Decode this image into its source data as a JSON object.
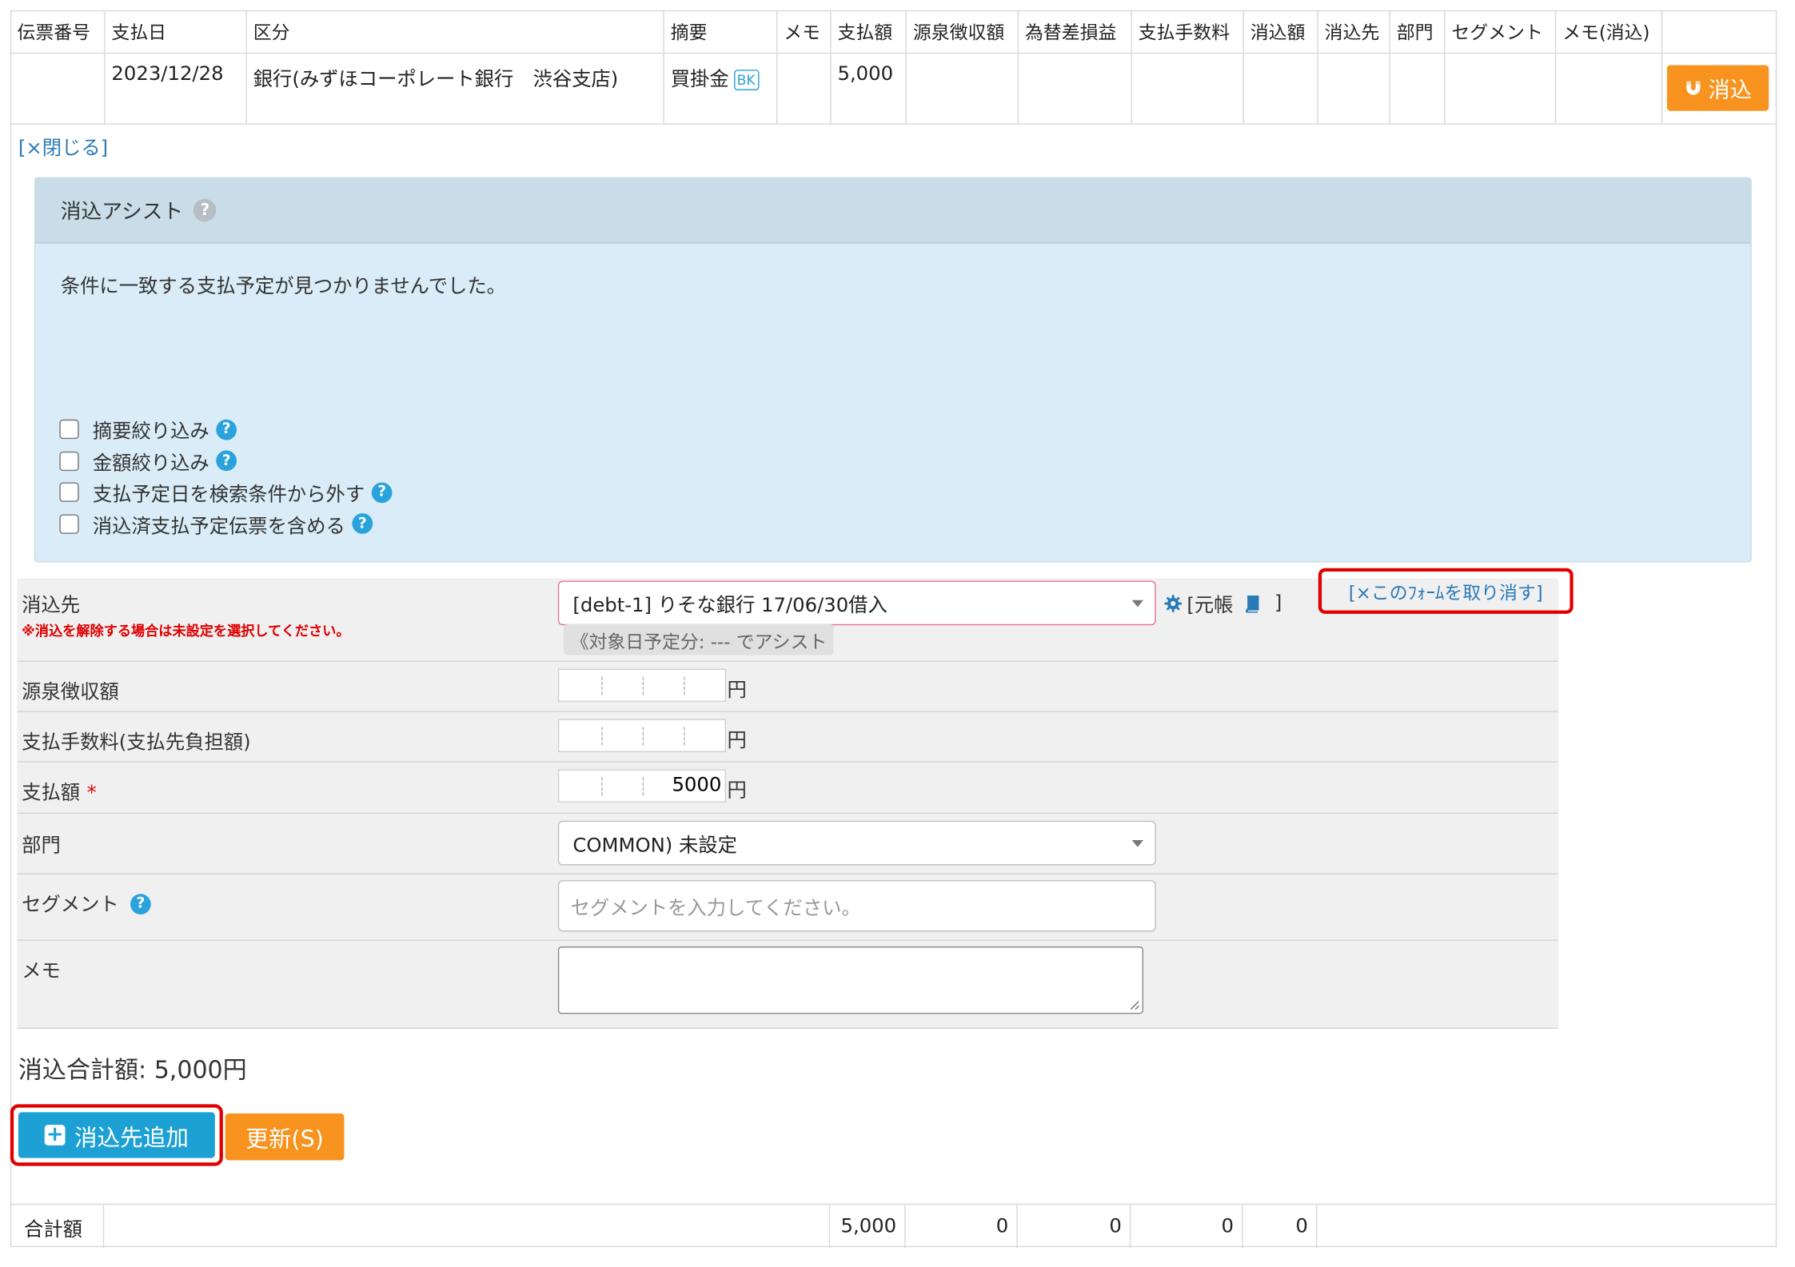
{
  "header": {
    "columns": [
      "伝票番号",
      "支払日",
      "区分",
      "摘要",
      "メモ",
      "支払額",
      "源泉徴収額",
      "為替差損益",
      "支払手数料",
      "消込額",
      "消込先",
      "部門",
      "セグメント",
      "メモ(消込)"
    ]
  },
  "entry": {
    "slip_no": "",
    "date": "2023/12/28",
    "category": "銀行(みずほコーポレート銀行　渋谷支店)",
    "summary": "買掛金",
    "summary_badge": "BK",
    "memo": "",
    "amount": "5,000",
    "withholding": "",
    "fx": "",
    "fee": "",
    "cleared": "",
    "target": "",
    "dept": "",
    "segment": "",
    "memo_clear": "",
    "clear_button": "消込"
  },
  "close_link": "[×閉じる]",
  "assist": {
    "title": "消込アシスト",
    "message": "条件に一致する支払予定が見つかりませんでした。",
    "options": [
      {
        "label": "摘要絞り込み",
        "checked": false
      },
      {
        "label": "金額絞り込み",
        "checked": false
      },
      {
        "label": "支払予定日を検索条件から外す",
        "checked": false
      },
      {
        "label": "消込済支払予定伝票を含める",
        "checked": false
      }
    ]
  },
  "form": {
    "target_label": "消込先",
    "target_note": "※消込を解除する場合は未設定を選択してください。",
    "target_value": "[debt-1] りそな銀行 17/06/30借入",
    "ledger_link": "[元帳",
    "ledger_close": "]",
    "assist_pill": "《対象日予定分: --- でアシスト",
    "cancel_link": "[×このﾌｫｰﾑを取り消す]",
    "withholding_label": "源泉徴収額",
    "withholding_value": "",
    "fee_label": "支払手数料(支払先負担額)",
    "fee_value": "",
    "amount_label": "支払額",
    "amount_required": "*",
    "amount_value": "5000",
    "yen": "円",
    "dept_label": "部門",
    "dept_value": "COMMON) 未設定",
    "segment_label": "セグメント",
    "segment_placeholder": "セグメントを入力してください。",
    "memo_label": "メモ",
    "memo_value": ""
  },
  "total_text": "消込合計額: 5,000円",
  "buttons": {
    "add_target": "消込先追加",
    "update": "更新(S)"
  },
  "summary_row": {
    "label": "合計額",
    "amount": "5,000",
    "withholding": "0",
    "fx": "0",
    "fee": "0",
    "cleared": "0"
  },
  "colors": {
    "orange": "#f7931e",
    "blue_button": "#1da1d4",
    "link": "#2b7ab8",
    "highlight_red": "#e00000",
    "assist_bg": "#d9ecf7"
  }
}
